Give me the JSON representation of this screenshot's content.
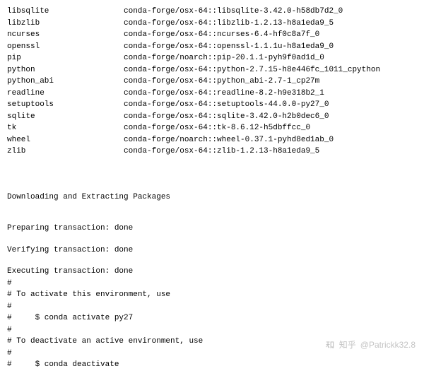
{
  "packages": [
    {
      "name": "libsqlite",
      "spec": "conda-forge/osx-64::libsqlite-3.42.0-h58db7d2_0"
    },
    {
      "name": "libzlib",
      "spec": "conda-forge/osx-64::libzlib-1.2.13-h8a1eda9_5"
    },
    {
      "name": "ncurses",
      "spec": "conda-forge/osx-64::ncurses-6.4-hf0c8a7f_0"
    },
    {
      "name": "openssl",
      "spec": "conda-forge/osx-64::openssl-1.1.1u-h8a1eda9_0"
    },
    {
      "name": "pip",
      "spec": "conda-forge/noarch::pip-20.1.1-pyh9f0ad1d_0"
    },
    {
      "name": "python",
      "spec": "conda-forge/osx-64::python-2.7.15-h8e446fc_1011_cpython"
    },
    {
      "name": "python_abi",
      "spec": "conda-forge/osx-64::python_abi-2.7-1_cp27m"
    },
    {
      "name": "readline",
      "spec": "conda-forge/osx-64::readline-8.2-h9e318b2_1"
    },
    {
      "name": "setuptools",
      "spec": "conda-forge/osx-64::setuptools-44.0.0-py27_0"
    },
    {
      "name": "sqlite",
      "spec": "conda-forge/osx-64::sqlite-3.42.0-h2b0dec6_0"
    },
    {
      "name": "tk",
      "spec": "conda-forge/osx-64::tk-8.6.12-h5dbffcc_0"
    },
    {
      "name": "wheel",
      "spec": "conda-forge/noarch::wheel-0.37.1-pyhd8ed1ab_0"
    },
    {
      "name": "zlib",
      "spec": "conda-forge/osx-64::zlib-1.2.13-h8a1eda9_5"
    }
  ],
  "sections": {
    "download": "Downloading and Extracting Packages",
    "prepare": "Preparing transaction: done",
    "verify": "Verifying transaction: done",
    "execute": "Executing transaction: done"
  },
  "comment_lines": {
    "c0": "#",
    "c1": "# To activate this environment, use",
    "c2": "#",
    "c3": "#     $ conda activate py27",
    "c4": "#",
    "c5": "# To deactivate an active environment, use",
    "c6": "#",
    "c7": "#     $ conda deactivate"
  },
  "watermark": {
    "platform": "知乎",
    "handle": "@Patrickk32.8"
  }
}
